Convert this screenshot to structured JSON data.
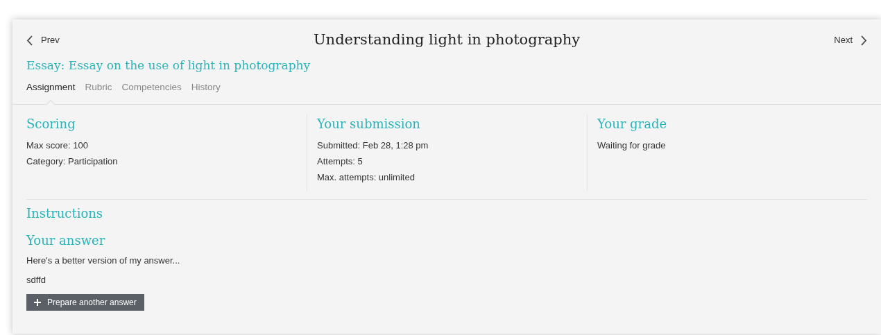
{
  "nav": {
    "prev": "Prev",
    "title": "Understanding light in photography",
    "next": "Next"
  },
  "assignment_title": "Essay: Essay on the use of light in photography",
  "tabs": [
    {
      "label": "Assignment",
      "selected": true
    },
    {
      "label": "Rubric",
      "selected": false
    },
    {
      "label": "Competencies",
      "selected": false
    },
    {
      "label": "History",
      "selected": false
    }
  ],
  "summary": [
    {
      "heading": "Scoring",
      "lines": [
        "Max score: 100",
        "Category: Participation"
      ]
    },
    {
      "heading": "Your submission",
      "lines": [
        "Submitted: Feb 28, 1:28 pm",
        "Attempts: 5",
        "Max. attempts: unlimited"
      ]
    },
    {
      "heading": "Your grade",
      "lines": [
        "Waiting for grade"
      ]
    }
  ],
  "instructions_heading": "Instructions",
  "answer": {
    "heading": "Your answer",
    "paragraphs": [
      "Here's a better version of my answer...",
      "sdffd"
    ],
    "button": "Prepare another answer"
  }
}
